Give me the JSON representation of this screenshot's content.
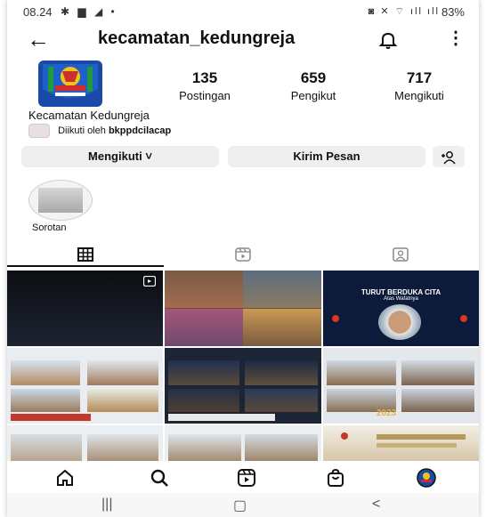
{
  "status_bar": {
    "time": "08.24",
    "left_icons": "✱ ▆ ◢ •",
    "right_icons": "◙ ✕ ⌔ ıll ıll",
    "battery": "83%"
  },
  "header": {
    "back_icon": "arrow-left-icon",
    "username": "kecamatan_kedungreja",
    "bell_icon": "bell-icon",
    "more_icon": "more-vertical-icon"
  },
  "profile": {
    "stats": [
      {
        "value": "135",
        "label": "Postingan"
      },
      {
        "value": "659",
        "label": "Pengikut"
      },
      {
        "value": "717",
        "label": "Mengikuti"
      }
    ],
    "full_name": "Kecamatan Kedungreja",
    "followed_prefix": "Diikuti oleh",
    "followed_by": "bkppdcilacap"
  },
  "buttons": {
    "following": "Mengikuti",
    "message": "Kirim Pesan"
  },
  "highlight": {
    "label": "Sorotan"
  },
  "tiles": {
    "tile3_title": "TURUT BERDUKA CITA",
    "tile3_sub": "Atas Wafatnya",
    "tile6_year": "2023"
  },
  "colors": {
    "text": "#111111",
    "button_bg": "#efefef",
    "divider": "#dbdbdb"
  }
}
